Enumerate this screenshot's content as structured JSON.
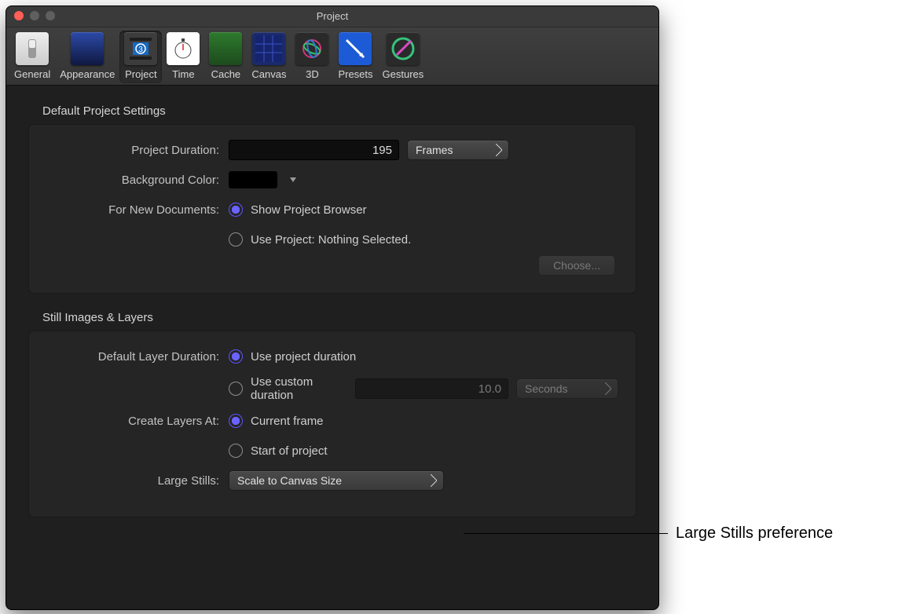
{
  "window": {
    "title": "Project"
  },
  "toolbar": {
    "items": [
      {
        "label": "General"
      },
      {
        "label": "Appearance"
      },
      {
        "label": "Project"
      },
      {
        "label": "Time"
      },
      {
        "label": "Cache"
      },
      {
        "label": "Canvas"
      },
      {
        "label": "3D"
      },
      {
        "label": "Presets"
      },
      {
        "label": "Gestures"
      }
    ],
    "selected_index": 2
  },
  "section1": {
    "title": "Default Project Settings",
    "project_duration_label": "Project Duration:",
    "project_duration_value": "195",
    "project_duration_unit": "Frames",
    "background_color_label": "Background Color:",
    "background_color_value": "#000000",
    "new_docs_label": "For New Documents:",
    "new_docs_option1": "Show Project Browser",
    "new_docs_option2": "Use Project: Nothing Selected.",
    "choose_button": "Choose..."
  },
  "section2": {
    "title": "Still Images & Layers",
    "layer_duration_label": "Default Layer Duration:",
    "layer_duration_option1": "Use project duration",
    "layer_duration_option2": "Use custom duration",
    "custom_duration_value": "10.0",
    "custom_duration_unit": "Seconds",
    "create_at_label": "Create Layers At:",
    "create_at_option1": "Current frame",
    "create_at_option2": "Start of project",
    "large_stills_label": "Large Stills:",
    "large_stills_value": "Scale to Canvas Size"
  },
  "callout": {
    "text": "Large Stills preference"
  }
}
